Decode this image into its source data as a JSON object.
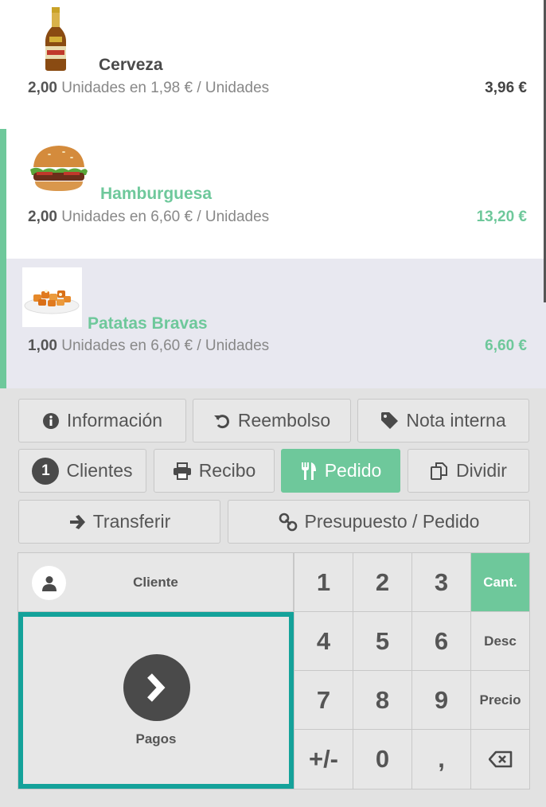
{
  "orderlines": [
    {
      "name": "Cerveza",
      "qty": "2,00",
      "unit_text": "Unidades en 1,98 € / Unidades",
      "price": "3,96 €",
      "image": "beer-bottle"
    },
    {
      "name": "Hamburguesa",
      "qty": "2,00",
      "unit_text": "Unidades en 6,60 € / Unidades",
      "price": "13,20 €",
      "image": "burger"
    },
    {
      "name": "Patatas Bravas",
      "qty": "1,00",
      "unit_text": "Unidades en 6,60 € / Unidades",
      "price": "6,60 €",
      "image": "patatas-bravas"
    }
  ],
  "controls": {
    "info": "Información",
    "refund": "Reembolso",
    "note": "Nota interna",
    "guests_count": "1",
    "guests": "Clientes",
    "bill": "Recibo",
    "order": "Pedido",
    "split": "Dividir",
    "transfer": "Transferir",
    "quotation": "Presupuesto / Pedido"
  },
  "pad": {
    "customer": "Cliente",
    "payment": "Pagos",
    "keys": [
      "1",
      "2",
      "3",
      "4",
      "5",
      "6",
      "7",
      "8",
      "9",
      "+/-",
      "0",
      ","
    ],
    "modes": {
      "qty": "Cant.",
      "disc": "Desc",
      "price": "Precio"
    }
  },
  "colors": {
    "accent": "#6ec89b",
    "payment_border": "#14a29a",
    "dark": "#4a4a4a"
  }
}
